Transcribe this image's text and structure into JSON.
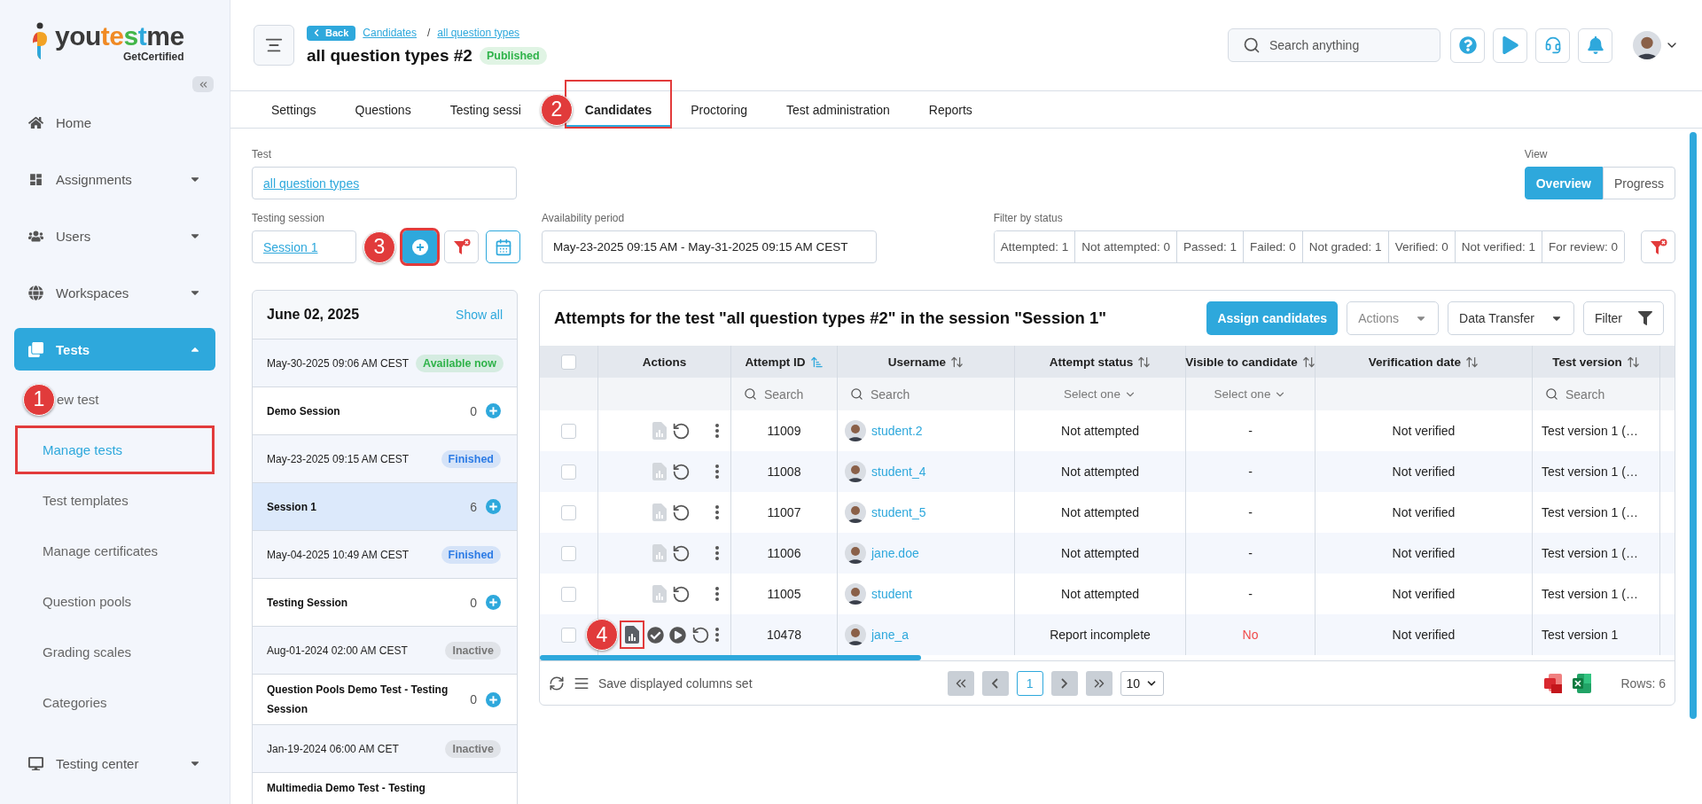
{
  "sidebar": {
    "logo": {
      "name": "youtestme",
      "tagline": "GetCertified"
    },
    "items": [
      {
        "label": "Home",
        "kind": "home",
        "expandable": false,
        "expanded": false,
        "selected": false
      },
      {
        "label": "Assignments",
        "kind": "assignments",
        "expandable": true,
        "expanded": false,
        "selected": false
      },
      {
        "label": "Users",
        "kind": "users",
        "expandable": true,
        "expanded": false,
        "selected": false
      },
      {
        "label": "Workspaces",
        "kind": "workspaces",
        "expandable": true,
        "expanded": false,
        "selected": false
      },
      {
        "label": "Tests",
        "kind": "tests",
        "expandable": true,
        "expanded": true,
        "selected": true,
        "children": [
          {
            "label": "ew test",
            "selected": false,
            "highlighted": false,
            "marker": "1"
          },
          {
            "label": "Manage tests",
            "selected": true,
            "highlighted": true
          },
          {
            "label": "Test templates",
            "selected": false,
            "highlighted": false
          },
          {
            "label": "Manage certificates",
            "selected": false,
            "highlighted": false
          },
          {
            "label": "Question pools",
            "selected": false,
            "highlighted": false
          },
          {
            "label": "Grading scales",
            "selected": false,
            "highlighted": false
          },
          {
            "label": "Categories",
            "selected": false,
            "highlighted": false
          }
        ]
      },
      {
        "label": "Testing center",
        "kind": "monitor",
        "expandable": true,
        "expanded": false,
        "selected": false
      }
    ]
  },
  "header": {
    "back": "Back",
    "breadcrumb": [
      "Candidates",
      "all question types"
    ],
    "separator": "/",
    "title": "all question types #2",
    "status": "Published",
    "search": {
      "placeholder": "Search anything"
    },
    "actions": [
      {
        "kind": "help"
      },
      {
        "kind": "play"
      },
      {
        "kind": "support"
      },
      {
        "kind": "notifications"
      }
    ]
  },
  "tabs": [
    {
      "label": "Settings",
      "selected": false,
      "highlighted": false
    },
    {
      "label": "Questions",
      "selected": false,
      "highlighted": false
    },
    {
      "label": "Testing sessi",
      "selected": false,
      "highlighted": false
    },
    {
      "label": "Candidates",
      "selected": true,
      "highlighted": true,
      "marker": "2"
    },
    {
      "label": "Proctoring",
      "selected": false,
      "highlighted": false
    },
    {
      "label": "Test administration",
      "selected": false,
      "highlighted": false
    },
    {
      "label": "Reports",
      "selected": false,
      "highlighted": false
    }
  ],
  "filters": {
    "test": {
      "label": "Test",
      "value": "all question types"
    },
    "view": {
      "label": "View",
      "options": [
        {
          "label": "Overview",
          "selected": true
        },
        {
          "label": "Progress",
          "selected": false
        }
      ]
    },
    "session": {
      "label": "Testing session",
      "value": "Session 1"
    },
    "add_session": {
      "highlighted": true,
      "marker": "3"
    },
    "availability": {
      "label": "Availability period",
      "value": "May-23-2025 09:15 AM - May-31-2025 09:15 AM CEST"
    },
    "status_filter": {
      "label": "Filter by status",
      "options": [
        "Attempted: 1",
        "Not attempted: 0",
        "Passed: 1",
        "Failed: 0",
        "Not graded: 1",
        "Verified: 0",
        "Not verified: 1",
        "For review: 0"
      ]
    }
  },
  "sessions": {
    "date": "June 02, 2025",
    "show_all": "Show all",
    "entries": [
      {
        "kind": "period",
        "date": "May-30-2025 09:06 AM CEST",
        "status": "Available now",
        "color": "#2fb34a",
        "selected": false
      },
      {
        "kind": "session",
        "name": "Demo Session",
        "count": "0",
        "selected": false
      },
      {
        "kind": "period",
        "date": "May-23-2025 09:15 AM CEST",
        "status": "Finished",
        "color": "#2c7be5",
        "selected": false
      },
      {
        "kind": "session",
        "name": "Session 1",
        "count": "6",
        "selected": true
      },
      {
        "kind": "period",
        "date": "May-04-2025 10:49 AM CEST",
        "status": "Finished",
        "color": "#2c7be5",
        "selected": false
      },
      {
        "kind": "session",
        "name": "Testing Session",
        "count": "0",
        "selected": false
      },
      {
        "kind": "period",
        "date": "Aug-01-2024 02:00 AM CEST",
        "status": "Inactive",
        "color": "#777777",
        "selected": false
      },
      {
        "kind": "session",
        "name": "Question Pools Demo Test - Testing Session",
        "count": "0",
        "selected": false
      },
      {
        "kind": "period",
        "date": "Jan-19-2024 06:00 AM CET",
        "status": "Inactive",
        "color": "#777777",
        "selected": false
      },
      {
        "kind": "session",
        "name": "Multimedia Demo Test - Testing",
        "selected": false
      }
    ]
  },
  "table": {
    "title": "Attempts for the test \"all question types #2\" in the session \"Session 1\"",
    "buttons": [
      {
        "label": "Assign candidates",
        "kind": "primary",
        "disabled": false
      },
      {
        "label": "Actions",
        "kind": "dropdown",
        "disabled": true
      },
      {
        "label": "Data Transfer",
        "kind": "dropdown",
        "disabled": false
      },
      {
        "label": "Filter",
        "kind": "filter",
        "disabled": false
      }
    ],
    "select_all": {
      "checked": false
    },
    "columns": [
      {
        "label": "Actions",
        "sortable": false,
        "sorted": false
      },
      {
        "label": "Attempt ID",
        "sortable": true,
        "sorted": true,
        "filter": {
          "kind": "search",
          "placeholder": "Search"
        }
      },
      {
        "label": "Username",
        "sortable": true,
        "sorted": false,
        "filter": {
          "kind": "search",
          "placeholder": "Search"
        }
      },
      {
        "label": "Attempt status",
        "sortable": true,
        "sorted": false,
        "filter": {
          "kind": "select",
          "placeholder": "Select one"
        }
      },
      {
        "label": "Visible to candidate",
        "sortable": true,
        "sorted": false,
        "filter": {
          "kind": "select",
          "placeholder": "Select one"
        }
      },
      {
        "label": "Verification date",
        "sortable": true,
        "sorted": false
      },
      {
        "label": "Test version",
        "sortable": true,
        "sorted": false,
        "filter": {
          "kind": "search",
          "placeholder": "Search"
        }
      }
    ],
    "rows": [
      {
        "checked": false,
        "kind": "basic",
        "report_disabled": true,
        "report_highlighted": false,
        "id": "11009",
        "username": "student.2",
        "status": "Not attempted",
        "visible": "-",
        "visible_alert": false,
        "verification": "Not verified",
        "version": "Test version 1 (…"
      },
      {
        "checked": false,
        "kind": "basic",
        "report_disabled": true,
        "report_highlighted": false,
        "id": "11008",
        "username": "student_4",
        "status": "Not attempted",
        "visible": "-",
        "visible_alert": false,
        "verification": "Not verified",
        "version": "Test version 1 (…"
      },
      {
        "checked": false,
        "kind": "basic",
        "report_disabled": true,
        "report_highlighted": false,
        "id": "11007",
        "username": "student_5",
        "status": "Not attempted",
        "visible": "-",
        "visible_alert": false,
        "verification": "Not verified",
        "version": "Test version 1 (…"
      },
      {
        "checked": false,
        "kind": "basic",
        "report_disabled": true,
        "report_highlighted": false,
        "id": "11006",
        "username": "jane.doe",
        "status": "Not attempted",
        "visible": "-",
        "visible_alert": false,
        "verification": "Not verified",
        "version": "Test version 1 (…"
      },
      {
        "checked": false,
        "kind": "basic",
        "report_disabled": true,
        "report_highlighted": false,
        "id": "11005",
        "username": "student",
        "status": "Not attempted",
        "visible": "-",
        "visible_alert": false,
        "verification": "Not verified",
        "version": "Test version 1 (…"
      },
      {
        "checked": false,
        "kind": "full",
        "report_disabled": false,
        "report_highlighted": true,
        "marker": "4",
        "id": "10478",
        "username": "jane_a",
        "status": "Report incomplete",
        "visible": "No",
        "visible_alert": true,
        "verification": "Not verified",
        "version": "Test version 1"
      }
    ],
    "footer": {
      "save_columns": "Save displayed columns set",
      "pages": [
        {
          "label": "1",
          "selected": true
        }
      ],
      "page_size": "10",
      "rows": "Rows: 6"
    }
  }
}
